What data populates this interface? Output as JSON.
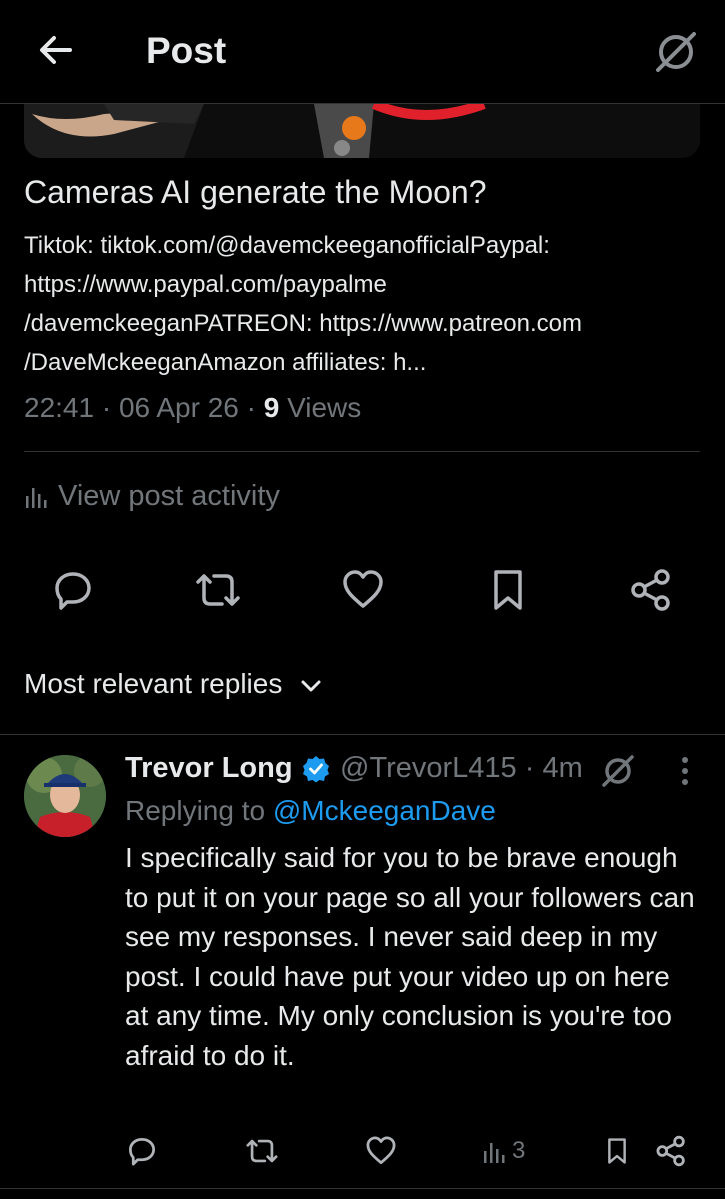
{
  "header": {
    "title": "Post"
  },
  "card": {
    "title": "Cameras AI generate the Moon?",
    "description": "Tiktok: tiktok.com/@davemckeeganofficialPaypal:\nhttps://www.paypal.com/paypalme\n/davemckeeganPATREON: https://www.patreon.com\n/DaveMckeeganAmazon affiliates: h..."
  },
  "post_meta": {
    "time": "22:41",
    "date": "06 Apr 26",
    "views_count": "9",
    "views_label": "Views"
  },
  "activity": {
    "label": "View post activity"
  },
  "actions": {
    "icons": [
      "reply-icon",
      "repost-icon",
      "like-icon",
      "bookmark-icon",
      "share-icon"
    ]
  },
  "replies_header": {
    "label": "Most relevant replies"
  },
  "reply": {
    "name": "Trevor Long",
    "handle": "@TrevorL415",
    "time": "4m",
    "replying_prefix": "Replying to",
    "replying_to": "@MckeeganDave",
    "text": "I specifically said for you to be brave enough to put it on your page so all your followers can see my responses. I never said deep in my post. I could have put your video up on here at any time. My only conclusion is you're too afraid to do it.",
    "views": "3"
  },
  "colors": {
    "background": "#000000",
    "text": "#e7e9ea",
    "muted": "#71767b",
    "accent": "#1d9bf0",
    "divider": "#2f3336"
  }
}
